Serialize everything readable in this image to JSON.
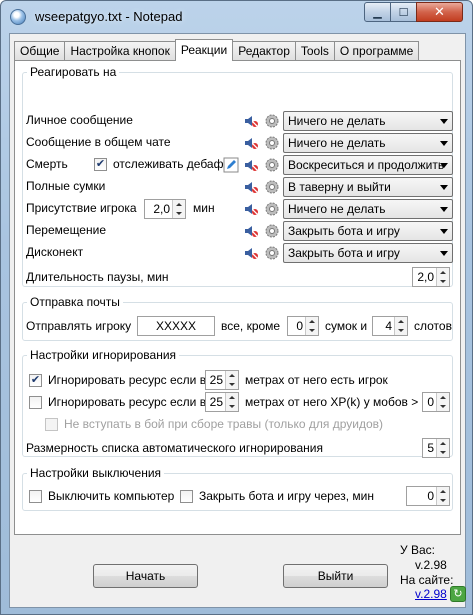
{
  "window": {
    "title": "wseepatgyo.txt - Notepad"
  },
  "tabs": [
    "Общие",
    "Настройка кнопок",
    "Реакции",
    "Редактор",
    "Tools",
    "О программе"
  ],
  "react": {
    "legend": "Реагировать на",
    "rows": [
      {
        "label": "Личное сообщение",
        "action": "Ничего не делать"
      },
      {
        "label": "Сообщение в общем чате",
        "action": "Ничего не делать"
      },
      {
        "label": "Смерть",
        "action": "Воскреситься и продолжить"
      },
      {
        "label": "Полные сумки",
        "action": "В таверну и выйти"
      },
      {
        "label": "Присутствие игрока",
        "action": "Ничего не делать"
      },
      {
        "label": "Перемещение",
        "action": "Закрыть бота и игру"
      },
      {
        "label": "Дисконект",
        "action": "Закрыть бота и игру"
      }
    ],
    "debuff_label": "отслеживать дебаф",
    "player_presence_value": "2,0",
    "player_presence_unit": "мин",
    "pause_label": "Длительность паузы, мин",
    "pause_value": "2,0"
  },
  "mail": {
    "legend": "Отправка почты",
    "send_label": "Отправлять игроку",
    "player_name": "XXXXX",
    "all_except": "все, кроме",
    "bags_value": "0",
    "bags_label": "сумок и",
    "slots_value": "4",
    "slots_label": "слотов"
  },
  "ignore": {
    "legend": "Настройки игнорирования",
    "row1_label": "Игнорировать ресурс если в",
    "row1_value": "25",
    "row1_suffix": "метрах от него есть игрок",
    "row2_label": "Игнорировать ресурс если в",
    "row2_value": "25",
    "row2_suffix": "метрах от него XP(k) у мобов >",
    "row2_xp": "0",
    "row3_label": "Не вступать в бой при сборе травы (только для друидов)",
    "list_label": "Размерность списка автоматического игнорирования",
    "list_value": "5"
  },
  "shutdown": {
    "legend": "Настройки выключения",
    "pc_label": "Выключить компьютер",
    "close_label": "Закрыть бота и игру через, мин",
    "close_value": "0"
  },
  "footer": {
    "start_label": "Начать",
    "exit_label": "Выйти",
    "you_have_label": "У Вас:",
    "current_version": "v.2.98",
    "site_label": "На сайте:",
    "site_version": "v.2.98"
  }
}
